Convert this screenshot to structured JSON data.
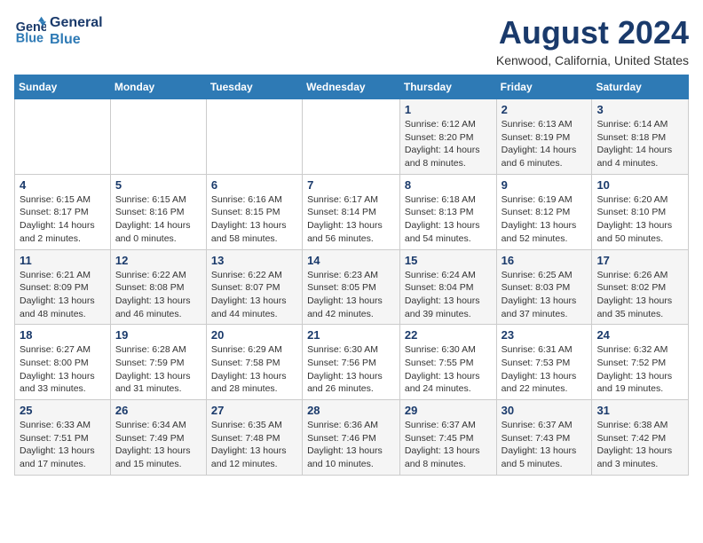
{
  "logo": {
    "line1": "General",
    "line2": "Blue"
  },
  "title": "August 2024",
  "subtitle": "Kenwood, California, United States",
  "days_of_week": [
    "Sunday",
    "Monday",
    "Tuesday",
    "Wednesday",
    "Thursday",
    "Friday",
    "Saturday"
  ],
  "weeks": [
    [
      {
        "day": "",
        "info": ""
      },
      {
        "day": "",
        "info": ""
      },
      {
        "day": "",
        "info": ""
      },
      {
        "day": "",
        "info": ""
      },
      {
        "day": "1",
        "info": "Sunrise: 6:12 AM\nSunset: 8:20 PM\nDaylight: 14 hours and 8 minutes."
      },
      {
        "day": "2",
        "info": "Sunrise: 6:13 AM\nSunset: 8:19 PM\nDaylight: 14 hours and 6 minutes."
      },
      {
        "day": "3",
        "info": "Sunrise: 6:14 AM\nSunset: 8:18 PM\nDaylight: 14 hours and 4 minutes."
      }
    ],
    [
      {
        "day": "4",
        "info": "Sunrise: 6:15 AM\nSunset: 8:17 PM\nDaylight: 14 hours and 2 minutes."
      },
      {
        "day": "5",
        "info": "Sunrise: 6:15 AM\nSunset: 8:16 PM\nDaylight: 14 hours and 0 minutes."
      },
      {
        "day": "6",
        "info": "Sunrise: 6:16 AM\nSunset: 8:15 PM\nDaylight: 13 hours and 58 minutes."
      },
      {
        "day": "7",
        "info": "Sunrise: 6:17 AM\nSunset: 8:14 PM\nDaylight: 13 hours and 56 minutes."
      },
      {
        "day": "8",
        "info": "Sunrise: 6:18 AM\nSunset: 8:13 PM\nDaylight: 13 hours and 54 minutes."
      },
      {
        "day": "9",
        "info": "Sunrise: 6:19 AM\nSunset: 8:12 PM\nDaylight: 13 hours and 52 minutes."
      },
      {
        "day": "10",
        "info": "Sunrise: 6:20 AM\nSunset: 8:10 PM\nDaylight: 13 hours and 50 minutes."
      }
    ],
    [
      {
        "day": "11",
        "info": "Sunrise: 6:21 AM\nSunset: 8:09 PM\nDaylight: 13 hours and 48 minutes."
      },
      {
        "day": "12",
        "info": "Sunrise: 6:22 AM\nSunset: 8:08 PM\nDaylight: 13 hours and 46 minutes."
      },
      {
        "day": "13",
        "info": "Sunrise: 6:22 AM\nSunset: 8:07 PM\nDaylight: 13 hours and 44 minutes."
      },
      {
        "day": "14",
        "info": "Sunrise: 6:23 AM\nSunset: 8:05 PM\nDaylight: 13 hours and 42 minutes."
      },
      {
        "day": "15",
        "info": "Sunrise: 6:24 AM\nSunset: 8:04 PM\nDaylight: 13 hours and 39 minutes."
      },
      {
        "day": "16",
        "info": "Sunrise: 6:25 AM\nSunset: 8:03 PM\nDaylight: 13 hours and 37 minutes."
      },
      {
        "day": "17",
        "info": "Sunrise: 6:26 AM\nSunset: 8:02 PM\nDaylight: 13 hours and 35 minutes."
      }
    ],
    [
      {
        "day": "18",
        "info": "Sunrise: 6:27 AM\nSunset: 8:00 PM\nDaylight: 13 hours and 33 minutes."
      },
      {
        "day": "19",
        "info": "Sunrise: 6:28 AM\nSunset: 7:59 PM\nDaylight: 13 hours and 31 minutes."
      },
      {
        "day": "20",
        "info": "Sunrise: 6:29 AM\nSunset: 7:58 PM\nDaylight: 13 hours and 28 minutes."
      },
      {
        "day": "21",
        "info": "Sunrise: 6:30 AM\nSunset: 7:56 PM\nDaylight: 13 hours and 26 minutes."
      },
      {
        "day": "22",
        "info": "Sunrise: 6:30 AM\nSunset: 7:55 PM\nDaylight: 13 hours and 24 minutes."
      },
      {
        "day": "23",
        "info": "Sunrise: 6:31 AM\nSunset: 7:53 PM\nDaylight: 13 hours and 22 minutes."
      },
      {
        "day": "24",
        "info": "Sunrise: 6:32 AM\nSunset: 7:52 PM\nDaylight: 13 hours and 19 minutes."
      }
    ],
    [
      {
        "day": "25",
        "info": "Sunrise: 6:33 AM\nSunset: 7:51 PM\nDaylight: 13 hours and 17 minutes."
      },
      {
        "day": "26",
        "info": "Sunrise: 6:34 AM\nSunset: 7:49 PM\nDaylight: 13 hours and 15 minutes."
      },
      {
        "day": "27",
        "info": "Sunrise: 6:35 AM\nSunset: 7:48 PM\nDaylight: 13 hours and 12 minutes."
      },
      {
        "day": "28",
        "info": "Sunrise: 6:36 AM\nSunset: 7:46 PM\nDaylight: 13 hours and 10 minutes."
      },
      {
        "day": "29",
        "info": "Sunrise: 6:37 AM\nSunset: 7:45 PM\nDaylight: 13 hours and 8 minutes."
      },
      {
        "day": "30",
        "info": "Sunrise: 6:37 AM\nSunset: 7:43 PM\nDaylight: 13 hours and 5 minutes."
      },
      {
        "day": "31",
        "info": "Sunrise: 6:38 AM\nSunset: 7:42 PM\nDaylight: 13 hours and 3 minutes."
      }
    ]
  ]
}
